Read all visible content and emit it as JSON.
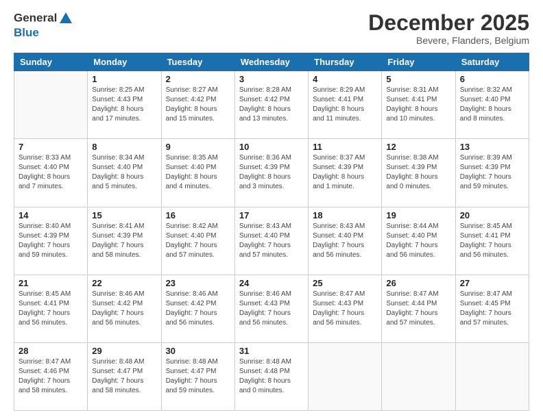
{
  "header": {
    "logo_line1": "General",
    "logo_line2": "Blue",
    "month": "December 2025",
    "location": "Bevere, Flanders, Belgium"
  },
  "weekdays": [
    "Sunday",
    "Monday",
    "Tuesday",
    "Wednesday",
    "Thursday",
    "Friday",
    "Saturday"
  ],
  "weeks": [
    [
      {
        "day": "",
        "info": ""
      },
      {
        "day": "1",
        "info": "Sunrise: 8:25 AM\nSunset: 4:43 PM\nDaylight: 8 hours\nand 17 minutes."
      },
      {
        "day": "2",
        "info": "Sunrise: 8:27 AM\nSunset: 4:42 PM\nDaylight: 8 hours\nand 15 minutes."
      },
      {
        "day": "3",
        "info": "Sunrise: 8:28 AM\nSunset: 4:42 PM\nDaylight: 8 hours\nand 13 minutes."
      },
      {
        "day": "4",
        "info": "Sunrise: 8:29 AM\nSunset: 4:41 PM\nDaylight: 8 hours\nand 11 minutes."
      },
      {
        "day": "5",
        "info": "Sunrise: 8:31 AM\nSunset: 4:41 PM\nDaylight: 8 hours\nand 10 minutes."
      },
      {
        "day": "6",
        "info": "Sunrise: 8:32 AM\nSunset: 4:40 PM\nDaylight: 8 hours\nand 8 minutes."
      }
    ],
    [
      {
        "day": "7",
        "info": "Sunrise: 8:33 AM\nSunset: 4:40 PM\nDaylight: 8 hours\nand 7 minutes."
      },
      {
        "day": "8",
        "info": "Sunrise: 8:34 AM\nSunset: 4:40 PM\nDaylight: 8 hours\nand 5 minutes."
      },
      {
        "day": "9",
        "info": "Sunrise: 8:35 AM\nSunset: 4:40 PM\nDaylight: 8 hours\nand 4 minutes."
      },
      {
        "day": "10",
        "info": "Sunrise: 8:36 AM\nSunset: 4:39 PM\nDaylight: 8 hours\nand 3 minutes."
      },
      {
        "day": "11",
        "info": "Sunrise: 8:37 AM\nSunset: 4:39 PM\nDaylight: 8 hours\nand 1 minute."
      },
      {
        "day": "12",
        "info": "Sunrise: 8:38 AM\nSunset: 4:39 PM\nDaylight: 8 hours\nand 0 minutes."
      },
      {
        "day": "13",
        "info": "Sunrise: 8:39 AM\nSunset: 4:39 PM\nDaylight: 7 hours\nand 59 minutes."
      }
    ],
    [
      {
        "day": "14",
        "info": "Sunrise: 8:40 AM\nSunset: 4:39 PM\nDaylight: 7 hours\nand 59 minutes."
      },
      {
        "day": "15",
        "info": "Sunrise: 8:41 AM\nSunset: 4:39 PM\nDaylight: 7 hours\nand 58 minutes."
      },
      {
        "day": "16",
        "info": "Sunrise: 8:42 AM\nSunset: 4:40 PM\nDaylight: 7 hours\nand 57 minutes."
      },
      {
        "day": "17",
        "info": "Sunrise: 8:43 AM\nSunset: 4:40 PM\nDaylight: 7 hours\nand 57 minutes."
      },
      {
        "day": "18",
        "info": "Sunrise: 8:43 AM\nSunset: 4:40 PM\nDaylight: 7 hours\nand 56 minutes."
      },
      {
        "day": "19",
        "info": "Sunrise: 8:44 AM\nSunset: 4:40 PM\nDaylight: 7 hours\nand 56 minutes."
      },
      {
        "day": "20",
        "info": "Sunrise: 8:45 AM\nSunset: 4:41 PM\nDaylight: 7 hours\nand 56 minutes."
      }
    ],
    [
      {
        "day": "21",
        "info": "Sunrise: 8:45 AM\nSunset: 4:41 PM\nDaylight: 7 hours\nand 56 minutes."
      },
      {
        "day": "22",
        "info": "Sunrise: 8:46 AM\nSunset: 4:42 PM\nDaylight: 7 hours\nand 56 minutes."
      },
      {
        "day": "23",
        "info": "Sunrise: 8:46 AM\nSunset: 4:42 PM\nDaylight: 7 hours\nand 56 minutes."
      },
      {
        "day": "24",
        "info": "Sunrise: 8:46 AM\nSunset: 4:43 PM\nDaylight: 7 hours\nand 56 minutes."
      },
      {
        "day": "25",
        "info": "Sunrise: 8:47 AM\nSunset: 4:43 PM\nDaylight: 7 hours\nand 56 minutes."
      },
      {
        "day": "26",
        "info": "Sunrise: 8:47 AM\nSunset: 4:44 PM\nDaylight: 7 hours\nand 57 minutes."
      },
      {
        "day": "27",
        "info": "Sunrise: 8:47 AM\nSunset: 4:45 PM\nDaylight: 7 hours\nand 57 minutes."
      }
    ],
    [
      {
        "day": "28",
        "info": "Sunrise: 8:47 AM\nSunset: 4:46 PM\nDaylight: 7 hours\nand 58 minutes."
      },
      {
        "day": "29",
        "info": "Sunrise: 8:48 AM\nSunset: 4:47 PM\nDaylight: 7 hours\nand 58 minutes."
      },
      {
        "day": "30",
        "info": "Sunrise: 8:48 AM\nSunset: 4:47 PM\nDaylight: 7 hours\nand 59 minutes."
      },
      {
        "day": "31",
        "info": "Sunrise: 8:48 AM\nSunset: 4:48 PM\nDaylight: 8 hours\nand 0 minutes."
      },
      {
        "day": "",
        "info": ""
      },
      {
        "day": "",
        "info": ""
      },
      {
        "day": "",
        "info": ""
      }
    ]
  ]
}
